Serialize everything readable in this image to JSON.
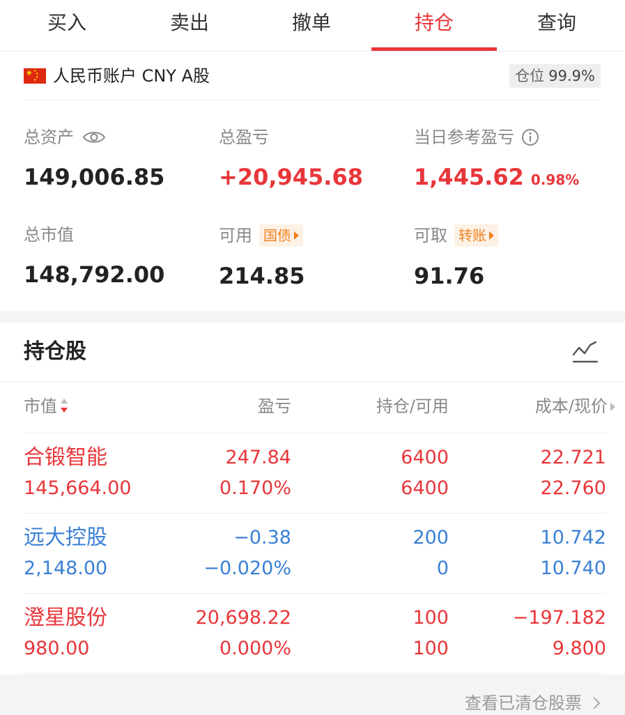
{
  "tabs": [
    {
      "label": "买入",
      "active": false
    },
    {
      "label": "卖出",
      "active": false
    },
    {
      "label": "撤单",
      "active": false
    },
    {
      "label": "持仓",
      "active": true
    },
    {
      "label": "查询",
      "active": false
    }
  ],
  "account": {
    "flag_icon": "cn-flag-icon",
    "name": "人民币账户 CNY A股",
    "position_label": "仓位",
    "position_value": "99.9%"
  },
  "metrics": {
    "total_assets": {
      "label": "总资产",
      "value": "149,006.85",
      "icon": "eye-icon"
    },
    "total_pnl": {
      "label": "总盈亏",
      "value": "+20,945.68"
    },
    "day_pnl": {
      "label": "当日参考盈亏",
      "value": "1,445.62",
      "pct": "0.98%",
      "icon": "info-icon"
    },
    "market_value": {
      "label": "总市值",
      "value": "148,792.00"
    },
    "available": {
      "label": "可用",
      "value": "214.85",
      "tag": "国债"
    },
    "withdrawable": {
      "label": "可取",
      "value": "91.76",
      "tag": "转账"
    }
  },
  "holdings": {
    "title": "持仓股",
    "chart_icon": "trend-chart-icon",
    "columns": [
      "市值",
      "盈亏",
      "持仓/可用",
      "成本/现价"
    ],
    "rows": [
      {
        "name": "合锻智能",
        "market_value": "145,664.00",
        "pnl": "247.84",
        "pnl_pct": "0.170%",
        "position": "6400",
        "available": "6400",
        "cost": "22.721",
        "price": "22.760",
        "color": "#e8363a"
      },
      {
        "name": "远大控股",
        "market_value": "2,148.00",
        "pnl": "−0.38",
        "pnl_pct": "−0.020%",
        "position": "200",
        "available": "0",
        "cost": "10.742",
        "price": "10.740",
        "color": "#3a7fd5"
      },
      {
        "name": "澄星股份",
        "market_value": "980.00",
        "pnl": "20,698.22",
        "pnl_pct": "0.000%",
        "position": "100",
        "available": "100",
        "cost": "−197.182",
        "price": "9.800",
        "color": "#e8363a"
      }
    ]
  },
  "footer": {
    "view_cleared": "查看已清仓股票"
  },
  "colors": {
    "accent_red": "#e8363a",
    "loss_blue": "#3a7fd5",
    "tag_orange": "#f0801e"
  }
}
